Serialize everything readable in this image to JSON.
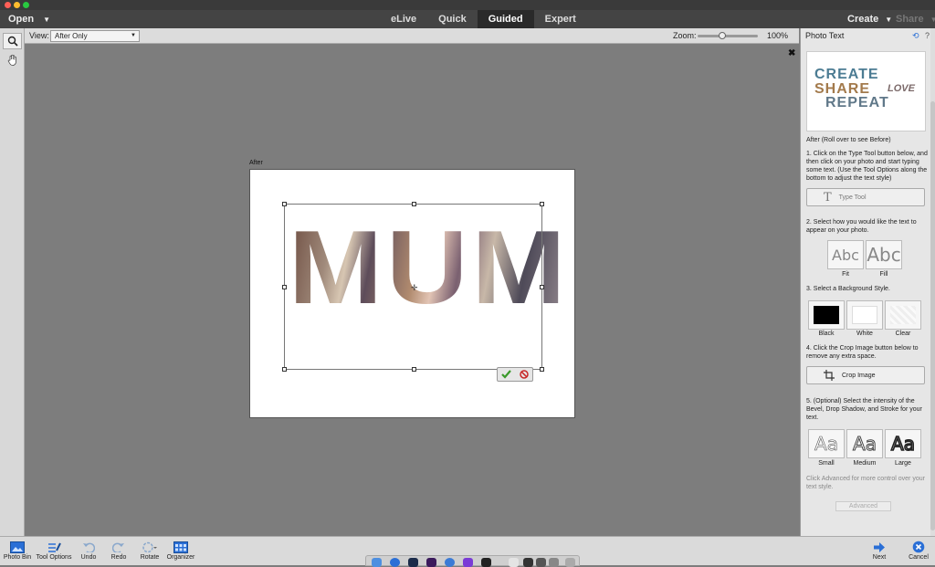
{
  "menubar": {
    "open_label": "Open",
    "modes": [
      "eLive",
      "Quick",
      "Guided",
      "Expert"
    ],
    "active_mode": "Guided",
    "create_label": "Create",
    "share_label": "Share"
  },
  "options_bar": {
    "view_label": "View:",
    "view_value": "After Only",
    "zoom_label": "Zoom:",
    "zoom_value": "100%",
    "zoom_slider_fraction": 0.4
  },
  "canvas": {
    "after_label": "After",
    "photo_text": "MUM"
  },
  "panel": {
    "title": "Photo Text",
    "preview": {
      "line1": "CREATE",
      "line2": "SHARE",
      "line3": "LOVE",
      "line4": "REPEAT"
    },
    "after_caption": "After (Roll over to see Before)",
    "step1": "1. Click on the Type Tool button below, and then click on your photo and start typing some text. (Use the Tool Options along the bottom to adjust the text style)",
    "type_tool_label": "Type Tool",
    "step2": "2. Select how you would like the text to appear on your photo.",
    "fit_label": "Fit",
    "fill_label": "Fill",
    "abc_glyph": "Abc",
    "step3": "3. Select a Background Style.",
    "bg_black": "Black",
    "bg_white": "White",
    "bg_clear": "Clear",
    "step4": "4. Click the Crop Image button below to remove any extra space.",
    "crop_label": "Crop Image",
    "step5": "5. (Optional) Select the intensity of the Bevel, Drop Shadow, and Stroke for your text.",
    "aa_glyph": "Aa",
    "small_label": "Small",
    "medium_label": "Medium",
    "large_label": "Large",
    "advanced_hint": "Click Advanced for more control over your text style.",
    "advanced_label": "Advanced"
  },
  "bottombar": {
    "photo_bin": "Photo Bin",
    "tool_options": "Tool Options",
    "undo": "Undo",
    "redo": "Redo",
    "rotate": "Rotate",
    "organizer": "Organizer",
    "next": "Next",
    "cancel": "Cancel"
  },
  "colors": {
    "accent_blue": "#2a6fd6",
    "commit_green": "#3a9a2a",
    "cancel_red": "#c82828"
  }
}
